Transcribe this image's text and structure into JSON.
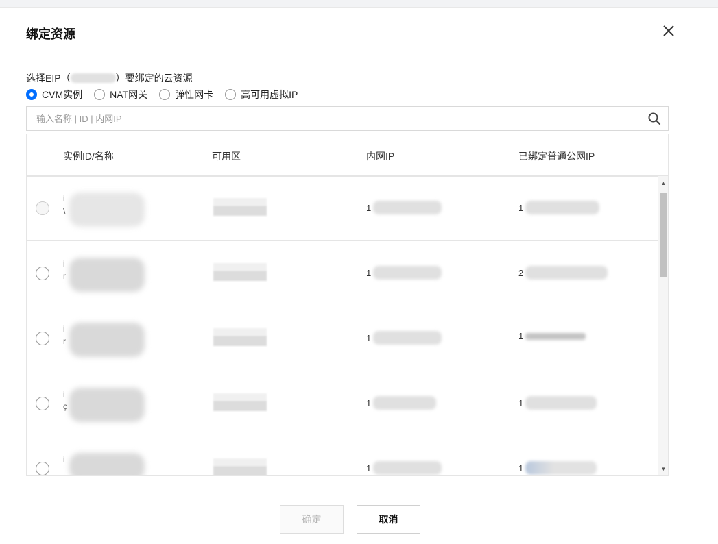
{
  "dialog": {
    "title": "绑定资源",
    "description_prefix": "选择EIP（",
    "description_suffix": "）要绑定的云资源"
  },
  "resource_types": [
    {
      "label": "CVM实例",
      "selected": true
    },
    {
      "label": "NAT网关",
      "selected": false
    },
    {
      "label": "弹性网卡",
      "selected": false
    },
    {
      "label": "高可用虚拟IP",
      "selected": false
    }
  ],
  "search": {
    "placeholder": "输入名称 | ID | 内网IP",
    "value": ""
  },
  "table": {
    "columns": [
      "实例ID/名称",
      "可用区",
      "内网IP",
      "已绑定普通公网IP"
    ],
    "rows": [
      {
        "id_lead": "i",
        "id_lead2": "\\",
        "private_ip_lead": "1",
        "public_ip_lead": "1",
        "disabled": true
      },
      {
        "id_lead": "i",
        "id_lead2": "r",
        "private_ip_lead": "1",
        "public_ip_lead": "2",
        "disabled": false
      },
      {
        "id_lead": "i",
        "id_lead2": "r",
        "private_ip_lead": "1",
        "public_ip_lead": "1",
        "disabled": false
      },
      {
        "id_lead": "i",
        "id_lead2": "ç",
        "private_ip_lead": "1",
        "public_ip_lead": "1",
        "disabled": false
      },
      {
        "id_lead": "i",
        "id_lead2": "",
        "private_ip_lead": "1",
        "public_ip_lead": "1",
        "disabled": false
      }
    ]
  },
  "footer": {
    "confirm_label": "确定",
    "cancel_label": "取消"
  },
  "colors": {
    "accent": "#006eff",
    "border": "#e5e5e5"
  },
  "icons": {
    "close": "close-icon",
    "search": "search-icon",
    "scroll_up": "caret-up-icon",
    "scroll_down": "caret-down-icon"
  }
}
